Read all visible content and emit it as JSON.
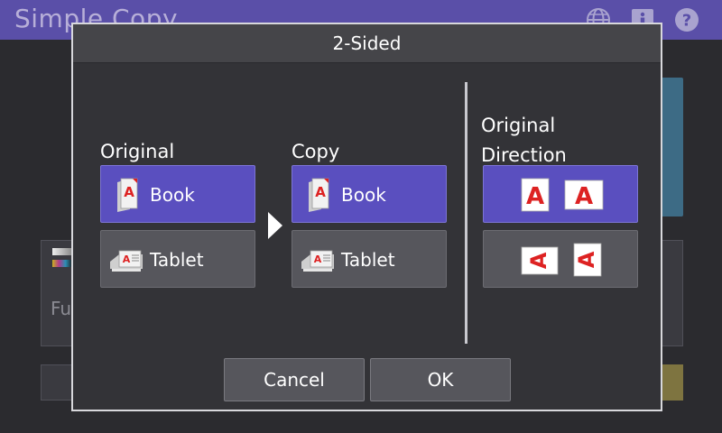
{
  "app": {
    "title": "Simple Copy",
    "header_icons": [
      "globe-icon",
      "info-icon",
      "help-icon"
    ],
    "background_text": "Fu",
    "accent_color": "#5a4fa8"
  },
  "dialog": {
    "title": "2-Sided",
    "original": {
      "label": "Original",
      "options": [
        {
          "label": "Book",
          "icon": "book-icon",
          "selected": true
        },
        {
          "label": "Tablet",
          "icon": "tablet-icon",
          "selected": false
        }
      ]
    },
    "copy": {
      "label": "Copy",
      "options": [
        {
          "label": "Book",
          "icon": "book-icon",
          "selected": true
        },
        {
          "label": "Tablet",
          "icon": "tablet-icon",
          "selected": false
        }
      ]
    },
    "direction": {
      "label_line1": "Original",
      "label_line2": "Direction",
      "options": [
        {
          "icon": "upright-pages-icon",
          "selected": true
        },
        {
          "icon": "rotated-pages-icon",
          "selected": false
        }
      ]
    },
    "footer": {
      "cancel_label": "Cancel",
      "ok_label": "OK"
    },
    "selected_color": "#5a4fbf"
  }
}
